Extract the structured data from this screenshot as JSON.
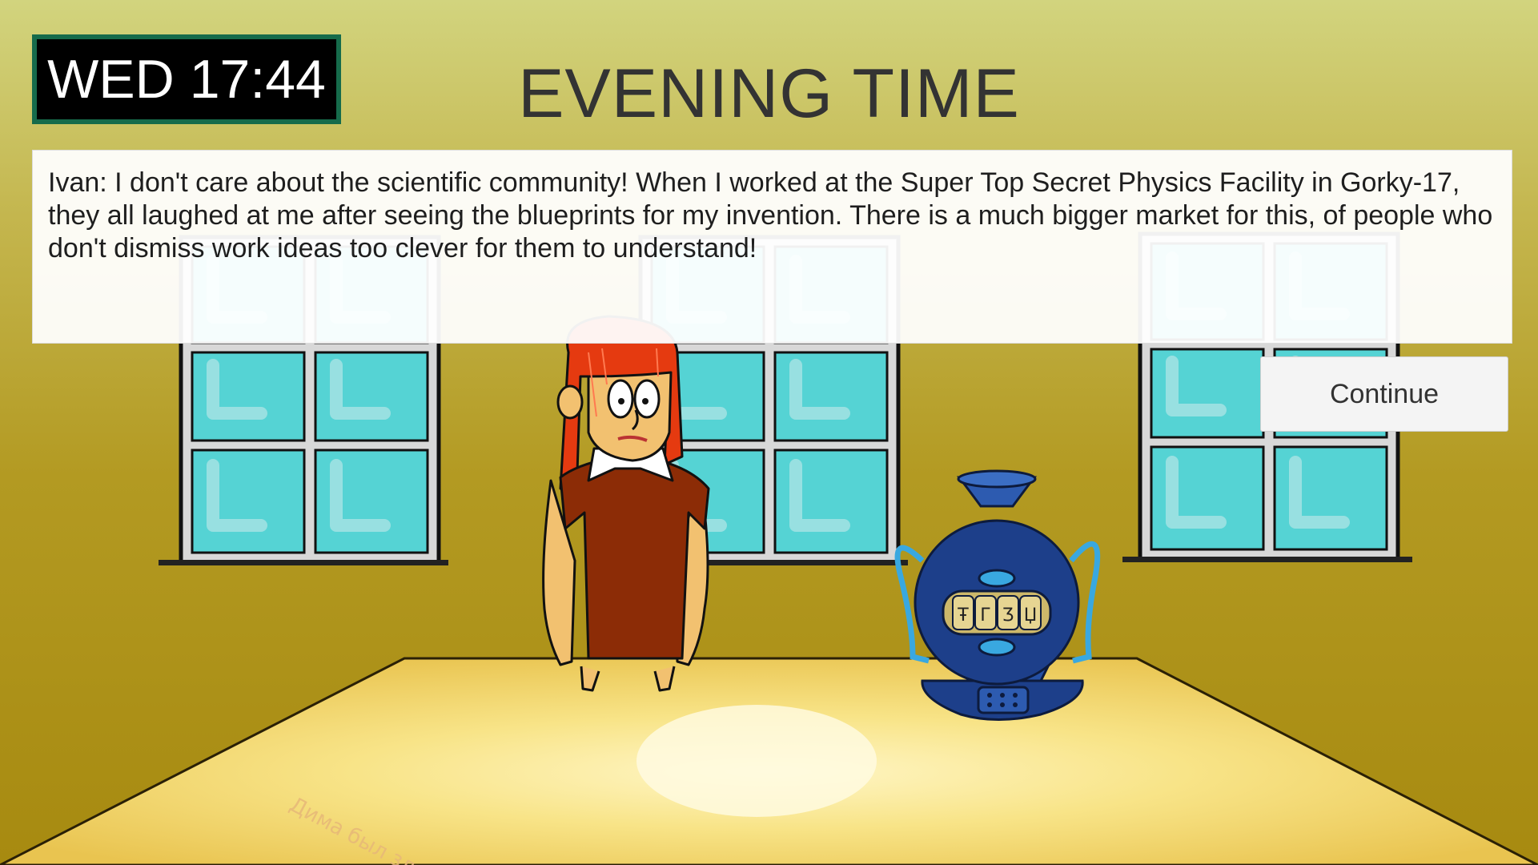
{
  "clock": {
    "day": "WED",
    "time": "17:44"
  },
  "phase_title": "EVENING TIME",
  "dialogue": {
    "speaker": "Ivan",
    "text": "Ivan: I don't care about the scientific community! When I worked at the Super Top Secret Physics Facility in Gorky-17, they all laughed at me after seeing the blueprints for my invention. There is a much bigger market for this, of people who don't dismiss work ideas too clever for them to understand!"
  },
  "continue_label": "Continue",
  "invention_symbols": [
    "Ŧ",
    "Г",
    "Ʒ",
    "Џ"
  ],
  "graffiti_text": "Дима был здесь!",
  "colors": {
    "wall_top": "#d2d47e",
    "wall_bottom": "#a78a10",
    "clock_border": "#166b4b",
    "window_glass": "#55d3d4",
    "table_top": "#f5de78",
    "ivan_shirt": "#8c2c06",
    "ivan_hair": "#e53a10",
    "invention_body": "#1d3f8a"
  }
}
